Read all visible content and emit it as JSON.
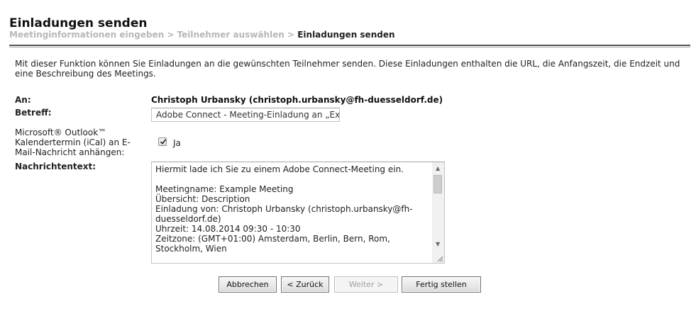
{
  "header": {
    "title": "Einladungen senden",
    "breadcrumb": {
      "step1": "Meetinginformationen eingeben",
      "sep1": " > ",
      "step2": "Teilnehmer auswählen",
      "sep2": " > ",
      "current": "Einladungen senden"
    }
  },
  "description": "Mit dieser Funktion können Sie Einladungen an die gewünschten Teilnehmer senden. Diese Einladungen enthalten die URL, die Anfangszeit, die Endzeit und eine Beschreibung des Meetings.",
  "form": {
    "to_label": "An:",
    "to_value": "Christoph Urbansky (christoph.urbansky@fh-duesseldorf.de)",
    "subject_label": "Betreff:",
    "subject_value": "Adobe Connect - Meeting-Einladung an „Example Meeting“",
    "outlook_label": "Microsoft® Outlook™ Kalendertermin (iCal) an E-Mail-Nachricht anhängen:",
    "outlook_checked": true,
    "outlook_option": "Ja",
    "message_label": "Nachrichtentext:",
    "message_value": "Hiermit lade ich Sie zu einem Adobe Connect-Meeting ein.\n\nMeetingname: Example Meeting\nÜbersicht: Description\nEinladung von: Christoph Urbansky (christoph.urbansky@fh-duesseldorf.de)\nUhrzeit: 14.08.2014 09:30 - 10:30\nZeitzone: (GMT+01:00) Amsterdam, Berlin, Bern, Rom, Stockholm, Wien"
  },
  "buttons": {
    "cancel": "Abbrechen",
    "back": "< Zurück",
    "next": "Weiter >",
    "finish": "Fertig stellen"
  },
  "icons": {
    "checkbox_checkmark": "checkmark-icon",
    "scroll_up": "chevron-up-icon",
    "scroll_down": "chevron-down-icon",
    "resize": "resize-grip-icon"
  }
}
